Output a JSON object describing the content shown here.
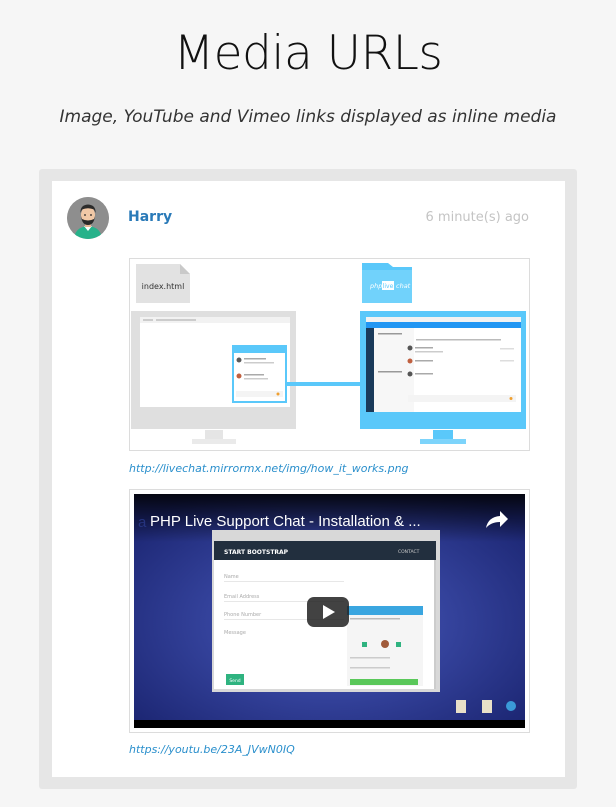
{
  "page": {
    "title": "Media URLs",
    "subtitle": "Image, YouTube and Vimeo links displayed as inline media"
  },
  "message": {
    "author": "Harry",
    "timestamp": "6 minute(s) ago"
  },
  "image_attachment": {
    "file_label": "index.html",
    "folder_label_left": "php",
    "folder_label_mid": "live",
    "folder_label_right": "chat",
    "url": "http://livechat.mirrormx.net/img/how_it_works.png"
  },
  "video_attachment": {
    "video_title": "PHP Live Support Chat - Installation & ...",
    "inner_heading": "START BOOTSTRAP",
    "inner_nav": "CONTACT",
    "form_fields": [
      "Name",
      "Email Address",
      "Phone Number",
      "Message"
    ],
    "send_label": "Send",
    "url": "https://youtu.be/23A_JVwN0IQ"
  },
  "colors": {
    "accent": "#2a7ab8",
    "link": "#2a8fcc",
    "chat_blue": "#5ac8fa",
    "video_bg": "#2f3d9a"
  }
}
